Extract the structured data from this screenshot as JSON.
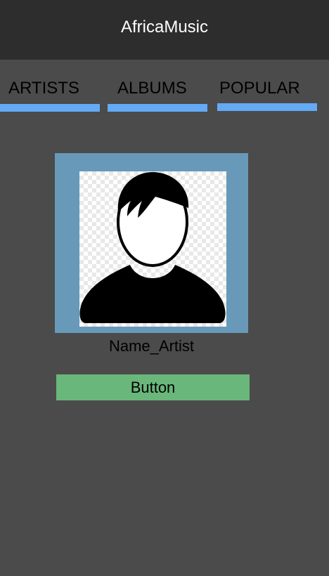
{
  "app_bar": {
    "title": "AfricaMusic"
  },
  "tabs": [
    {
      "label": "ARTISTS"
    },
    {
      "label": "ALBUMS"
    },
    {
      "label": "POPULAR"
    }
  ],
  "colors": {
    "app_bar": "#2d2d2d",
    "background": "#4b4b4b",
    "tab_indicator": "#64aaf5",
    "card": "#6899b8",
    "button": "#6ab77b"
  },
  "artist": {
    "name": "Name_Artist",
    "photo_icon": "user-silhouette-icon"
  },
  "button": {
    "label": "Button"
  }
}
